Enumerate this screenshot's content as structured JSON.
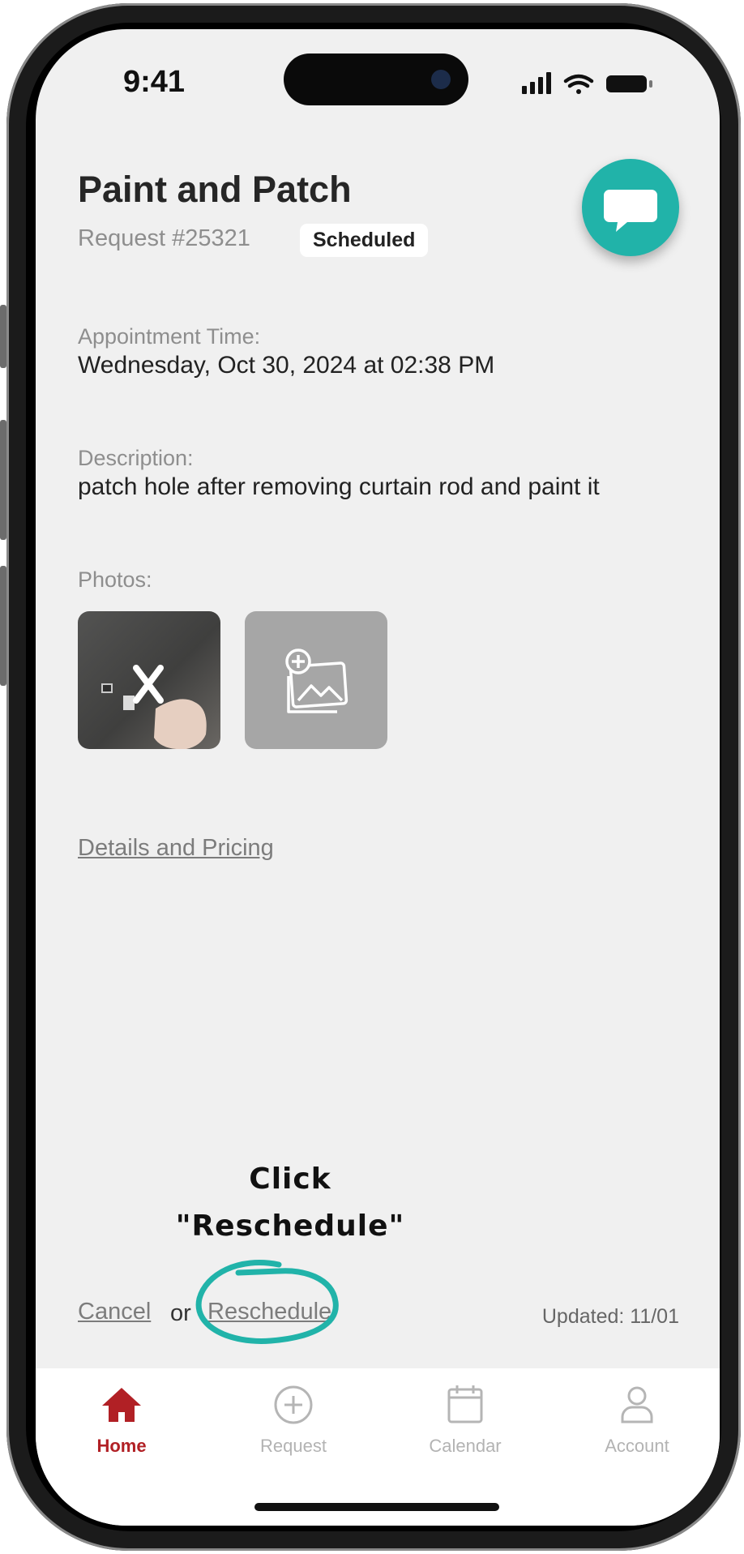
{
  "status_bar": {
    "time": "9:41"
  },
  "header": {
    "title": "Paint and Patch",
    "request_number": "Request #25321",
    "status_badge": "Scheduled"
  },
  "appointment": {
    "label": "Appointment Time:",
    "value": "Wednesday, Oct 30, 2024 at 02:38 PM"
  },
  "description": {
    "label": "Description:",
    "value": "patch hole after removing curtain rod and paint it"
  },
  "photos": {
    "label": "Photos:"
  },
  "details_link": "Details and Pricing",
  "annotation": {
    "line1": "Click",
    "line2": "\"Reschedule\""
  },
  "actions": {
    "cancel": "Cancel",
    "or": "or",
    "reschedule": "Reschedule",
    "updated": "Updated: 11/01"
  },
  "tabs": [
    {
      "label": "Home",
      "icon": "home-icon"
    },
    {
      "label": "Request",
      "icon": "plus-circle-icon"
    },
    {
      "label": "Calendar",
      "icon": "calendar-icon"
    },
    {
      "label": "Account",
      "icon": "user-icon"
    }
  ],
  "colors": {
    "accent": "#21b3a9",
    "active_tab": "#b12025"
  }
}
